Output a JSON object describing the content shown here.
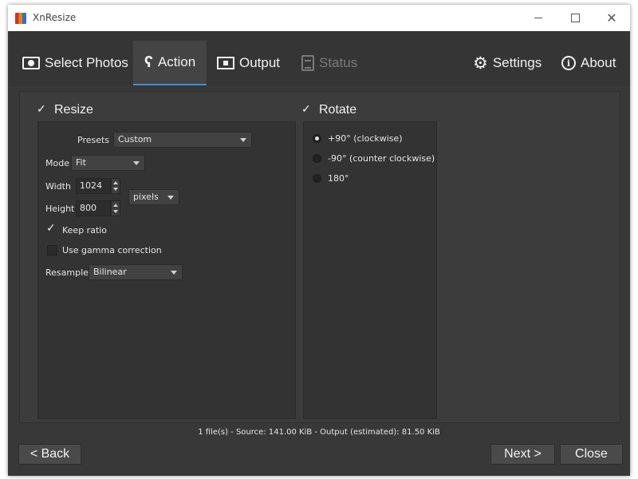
{
  "window": {
    "title": "XnResize"
  },
  "titlebar": {
    "minimize_glyph": "",
    "maximize_glyph": "",
    "close_glyph": "✕"
  },
  "tabs": [
    {
      "label": "Select Photos",
      "icon": "photos-icon",
      "state": "normal"
    },
    {
      "label": "Action",
      "icon": "action-icon",
      "state": "active"
    },
    {
      "label": "Output",
      "icon": "output-icon",
      "state": "normal"
    },
    {
      "label": "Status",
      "icon": "status-icon",
      "state": "disabled"
    }
  ],
  "right_tabs": [
    {
      "label": "Settings",
      "icon": "gear-icon"
    },
    {
      "label": "About",
      "icon": "info-icon"
    }
  ],
  "resize": {
    "label": "Resize",
    "checked": true,
    "presets_label": "Presets",
    "presets_value": "Custom",
    "mode_label": "Mode",
    "mode_value": "Fit",
    "width_label": "Width",
    "width_value": "1024",
    "height_label": "Height",
    "height_value": "800",
    "unit_value": "pixels",
    "keep_ratio_label": "Keep ratio",
    "keep_ratio_checked": true,
    "gamma_label": "Use gamma correction",
    "gamma_checked": false,
    "resample_label": "Resample",
    "resample_value": "Bilinear"
  },
  "rotate": {
    "label": "Rotate",
    "checked": true,
    "options": [
      {
        "label": "+90° (clockwise)",
        "selected": true
      },
      {
        "label": "-90° (counter clockwise)",
        "selected": false
      },
      {
        "label": "180°",
        "selected": false
      }
    ]
  },
  "status_line": "1 file(s) - Source: 141.00 KiB - Output (estimated): 81.50 KiB",
  "buttons": {
    "back": "< Back",
    "next": "Next >",
    "close": "Close"
  },
  "colors": {
    "accent": "#3d8fd6",
    "background": "#383838",
    "panel": "#333333"
  }
}
